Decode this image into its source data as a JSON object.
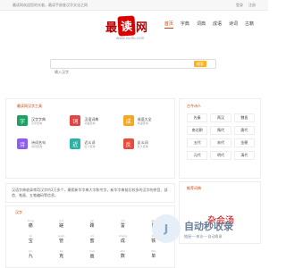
{
  "topbar": {
    "left": "最读网欢迎您的光临，最读手册查汉字文化之网",
    "right": [
      "登录",
      "注册"
    ]
  },
  "header": {
    "logo_text": "最读网",
    "logo_sub": "www.zuidu.com",
    "nav": [
      "首页",
      "字典",
      "词典",
      "成语",
      "诗词",
      "古籍"
    ]
  },
  "search": {
    "placeholder": "输入汉字",
    "button": "搜索"
  },
  "tools_section": {
    "title": "最读网汉字工具",
    "items": [
      {
        "label": "汉字字典",
        "sub": "汉字查询",
        "color": "#1aa260"
      },
      {
        "label": "汉语词典",
        "sub": "词语查询",
        "color": "#e64343"
      },
      {
        "label": "成语大全",
        "sub": "成语查询",
        "color": "#f5a623"
      },
      {
        "label": "诗词名句",
        "sub": "诗词查询",
        "color": "#8b5cf6"
      },
      {
        "label": "近义词",
        "sub": "近义查询",
        "color": "#2bb4a6"
      },
      {
        "label": "反义词",
        "sub": "反义查询",
        "color": "#e74c3c"
      }
    ]
  },
  "intro": "汉语字典收录常用汉字约2万多个，康熙新华字典大字和专字，新华字典前后较多的汉字的拼音、部首、笔画、五笔编码等信息。",
  "poem_section": {
    "title": "汉字",
    "rows": [
      [
        {
          "p": "tòng",
          "c": "痛"
        },
        {
          "p": "cuǒ",
          "c": "蹉"
        },
        {
          "p": "jié",
          "c": "蹀"
        },
        {
          "p": "shì",
          "c": "誓"
        },
        {
          "p": "gèn",
          "c": "艮"
        }
      ],
      [
        {
          "p": "bì",
          "c": "宝"
        },
        {
          "p": "guǎn",
          "c": "管"
        },
        {
          "p": "mì",
          "c": "蜜"
        },
        {
          "p": "chéng",
          "c": "成"
        },
        {
          "p": "tiě",
          "c": "铁"
        }
      ],
      [
        {
          "p": "jiǔ",
          "c": "九"
        },
        {
          "p": "kè",
          "c": "克"
        },
        {
          "p": "huà",
          "c": "画"
        },
        {
          "p": "shù",
          "c": "数"
        },
        {
          "p": "dān",
          "c": "单"
        }
      ]
    ]
  },
  "dynasty_section": {
    "title": "古今诗人",
    "items": [
      "先秦",
      "两汉",
      "魏晋",
      "南北朝",
      "隋代",
      "唐代",
      "五代",
      "宋代",
      "金朝",
      "元代",
      "明代",
      "清代"
    ]
  },
  "featured": {
    "title": "推荐词典",
    "art": "杂会汤"
  },
  "watermark": {
    "title": "自动秒收录",
    "sub": "链接一·来访一·自动收录"
  }
}
